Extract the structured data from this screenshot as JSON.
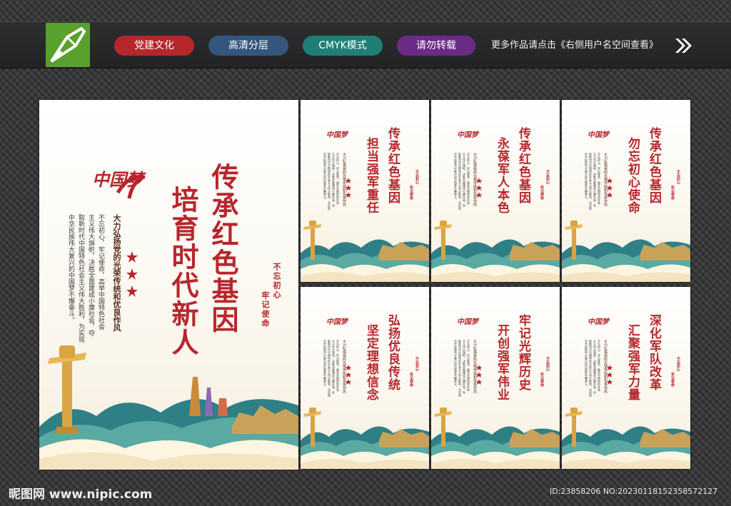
{
  "header": {
    "tags": [
      "党建文化",
      "高清分层",
      "CMYK模式",
      "请勿转载"
    ],
    "note": "更多作品请点击《右侧用户名空间查看》",
    "tag_colors": [
      "#b5272b",
      "#34557c",
      "#1f7f74",
      "#6a2a86"
    ],
    "logo_icon": "pen-nib-icon",
    "arrow_icon": "double-chevron-right-icon"
  },
  "main_board": {
    "title_col1": "传承红色基因",
    "title_col2": "培育时代新人",
    "stamp_col1": "不忘初心",
    "stamp_col2": "牢记使命",
    "emblem": "中国梦",
    "slogan": "大力弘扬党的光荣传统和优良作风",
    "body": [
      "不忘初心，牢记使命，高举中国特色社会",
      "主义伟大旗帜，决胜全面建成小康社会，夺",
      "取新时代中国特色社会主义伟大胜利，为实现",
      "中华民族伟大复兴的中国梦不懈奋斗。"
    ]
  },
  "small_boards": [
    {
      "title1": "传承红色基因",
      "title2": "担当强军重任"
    },
    {
      "title1": "传承红色基因",
      "title2": "永葆军人本色"
    },
    {
      "title1": "传承红色基因",
      "title2": "勿忘初心使命"
    },
    {
      "title1": "弘扬优良传统",
      "title2": "坚定理想信念"
    },
    {
      "title1": "牢记光辉历史",
      "title2": "开创强军伟业"
    },
    {
      "title1": "深化军队改革",
      "title2": "汇聚强军力量"
    }
  ],
  "small_board_common": {
    "stamp_col1": "不忘初心",
    "stamp_col2": "牢记使命",
    "emblem": "中国梦",
    "slogan": "大力弘扬党的光荣传统和优良作风",
    "body": [
      "不忘初心，牢记使命，高举中国特色社会",
      "主义伟大旗帜，决胜全面建成小康社会，夺",
      "取新时代中国特色社会主义伟大胜利，为实现",
      "中华民族伟大复兴的中国梦不懈奋斗。"
    ]
  },
  "footer": {
    "site": "昵图网 www.nipic.com",
    "id": "ID:23858206 NO:20230118152358572127"
  },
  "colors": {
    "accent_red": "#b7262c",
    "gold": "#d9a441",
    "teal": "#3f8f8c"
  }
}
